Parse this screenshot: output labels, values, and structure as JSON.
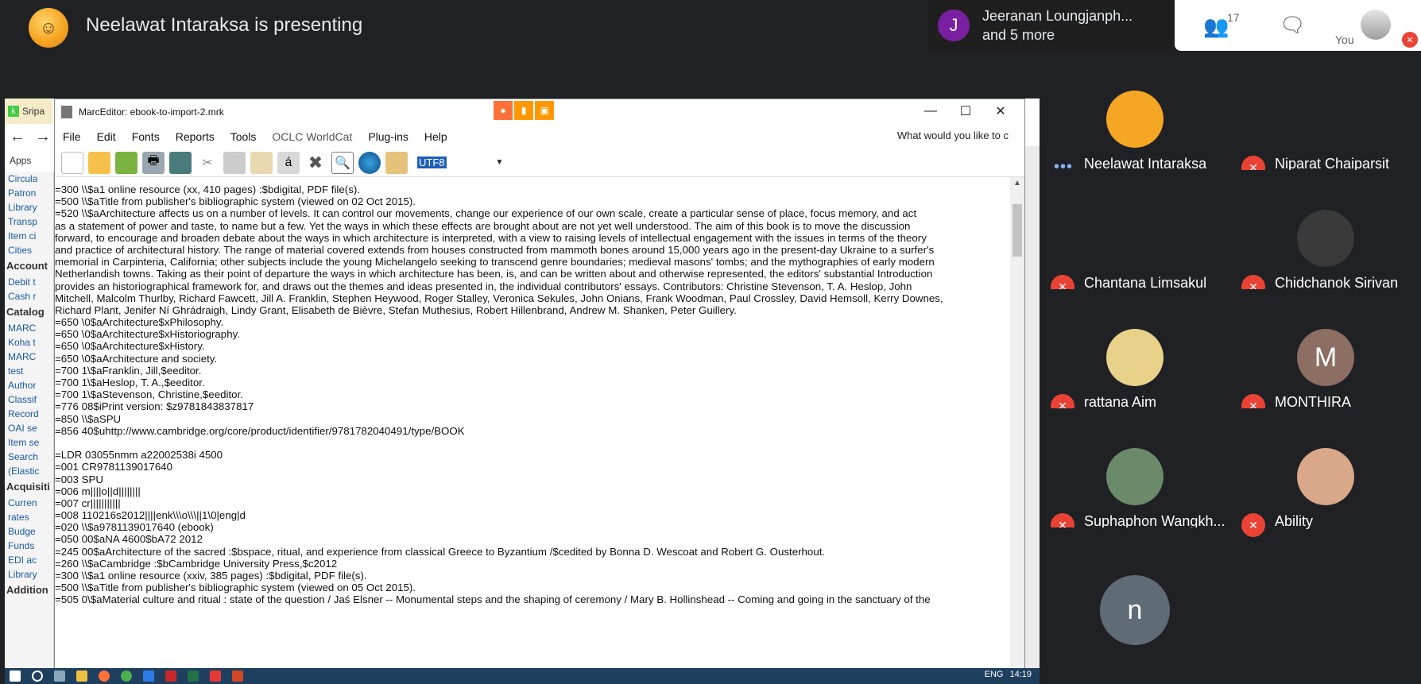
{
  "meet": {
    "presenting_text": "Neelawat Intaraksa is presenting",
    "top_participant": {
      "initial": "J",
      "line1": "Jeeranan Loungjanph...",
      "line2": "and 5 more",
      "color": "#7b1fa2"
    },
    "people_count": "17",
    "you_label": "You"
  },
  "browser": {
    "tab_label": "Sripa",
    "apps_label": "Apps"
  },
  "koha_sidebar": [
    {
      "t": "ln",
      "text": "Circula"
    },
    {
      "t": "ln",
      "text": "Patron"
    },
    {
      "t": "ln",
      "text": "Library"
    },
    {
      "t": "ln",
      "text": "Transp"
    },
    {
      "t": "ln",
      "text": "Item ci"
    },
    {
      "t": "ln",
      "text": "Cities"
    },
    {
      "t": "hd",
      "text": "Account"
    },
    {
      "t": "ln",
      "text": "Debit t"
    },
    {
      "t": "ln",
      "text": "Cash r"
    },
    {
      "t": "hd",
      "text": "Catalog"
    },
    {
      "t": "ln",
      "text": "MARC"
    },
    {
      "t": "ln",
      "text": "Koha t"
    },
    {
      "t": "ln",
      "text": "MARC"
    },
    {
      "t": "ln",
      "text": "test"
    },
    {
      "t": "ln",
      "text": "Author"
    },
    {
      "t": "ln",
      "text": "Classif"
    },
    {
      "t": "ln",
      "text": "Record"
    },
    {
      "t": "ln",
      "text": "OAI se"
    },
    {
      "t": "ln",
      "text": "Item se"
    },
    {
      "t": "ln",
      "text": "Search"
    },
    {
      "t": "ln",
      "text": "(Elastic"
    },
    {
      "t": "hd",
      "text": "Acquisiti"
    },
    {
      "t": "ln",
      "text": "Curren"
    },
    {
      "t": "ln",
      "text": "rates"
    },
    {
      "t": "ln",
      "text": "Budge"
    },
    {
      "t": "ln",
      "text": "Funds"
    },
    {
      "t": "ln",
      "text": "EDI ac"
    },
    {
      "t": "ln",
      "text": "Library"
    },
    {
      "t": "hd",
      "text": "Addition"
    }
  ],
  "marc": {
    "title": "MarcEditor: ebook-to-import-2.mrk",
    "window_controls": {
      "minimize": "—",
      "maximize": "☐",
      "close": "✕"
    },
    "menu": [
      "File",
      "Edit",
      "Fonts",
      "Reports",
      "Tools",
      "OCLC WorldCat",
      "Plug-ins",
      "Help"
    ],
    "search_hint": "What would you like to c",
    "encoding": "UTF8",
    "lines": [
      "=300  \\\\$a1 online resource (xx, 410 pages) :$bdigital, PDF file(s).",
      "=500  \\\\$aTitle from publisher's bibliographic system (viewed on 02 Oct 2015).",
      "=520  \\\\$aArchitecture affects us on a number of levels. It can control our movements, change our experience of our own scale, create a particular sense of place, focus memory, and act",
      "as a statement of power and taste, to name but a few. Yet the ways in which these effects are brought about are not yet well understood. The aim of this book is to move the discussion",
      "forward, to encourage and broaden debate about the ways in which architecture is interpreted, with a view to raising levels of intellectual engagement with the issues in terms of the theory",
      "and practice of architectural history. The range of material covered extends from houses constructed from mammoth bones around 15,000 years ago in the present-day Ukraine to a surfer's",
      "memorial in Carpinteria, California; other subjects include the young Michelangelo seeking to transcend genre boundaries; medieval masons' tombs; and the mythographies of early modern",
      "Netherlandish towns. Taking as their point of departure the ways in which architecture has been, is, and can be written about and otherwise represented, the editors' substantial Introduction",
      "provides an historiographical framework for, and draws out the themes and ideas presented in, the individual contributors' essays. Contributors: Christine Stevenson, T. A. Heslop, John",
      "Mitchell, Malcolm Thurlby, Richard Fawcett, Jill A. Franklin, Stephen Heywood, Roger Stalley, Veronica Sekules, John Onians, Frank Woodman, Paul Crossley, David Hemsoll, Kerry Downes,",
      "Richard Plant, Jenifer Ní Ghrádraigh, Lindy Grant, Elisabeth de Bièvre, Stefan Muthesius, Robert Hillenbrand, Andrew M. Shanken, Peter Guillery.",
      "=650  \\0$aArchitecture$xPhilosophy.",
      "=650  \\0$aArchitecture$xHistoriography.",
      "=650  \\0$aArchitecture$xHistory.",
      "=650  \\0$aArchitecture and society.",
      "=700  1\\$aFranklin, Jill,$eeditor.",
      "=700  1\\$aHeslop, T. A.,$eeditor.",
      "=700  1\\$aStevenson, Christine,$eeditor.",
      "=776  08$iPrint version: $z9781843837817",
      "=850  \\\\$aSPU",
      "=856  40$uhttp://www.cambridge.org/core/product/identifier/9781782040491/type/BOOK",
      "",
      "=LDR  03055nmm a22002538i 4500",
      "=001  CR9781139017640",
      "=003  SPU",
      "=006  m||||o||d||||||||",
      "=007  cr|||||||||||",
      "=008  110216s2012||||enk\\\\\\o\\\\\\||1\\0|eng|d",
      "=020  \\\\$a9781139017640 (ebook)",
      "=050  00$aNA 4600$bA72 2012",
      "=245  00$aArchitecture of the sacred :$bspace, ritual, and experience from classical Greece to Byzantium /$cedited by Bonna D. Wescoat and Robert G. Ousterhout.",
      "=260  \\\\$aCambridge :$bCambridge University Press,$c2012",
      "=300  \\\\$a1 online resource (xxiv, 385 pages) :$bdigital, PDF file(s).",
      "=500  \\\\$aTitle from publisher's bibliographic system (viewed on 05 Oct 2015).",
      "=505  0\\$aMaterial culture and ritual : state of the question / Jaś Elsner -- Monumental steps and the shaping of ceremony / Mary B. Hollinshead -- Coming and going in the sanctuary of the"
    ]
  },
  "taskbar": {
    "lang": "ENG",
    "time": "14:19"
  },
  "participants": [
    {
      "name": "Neelawat Intaraksa",
      "speaking": true,
      "avatar_color": "#f5a623",
      "initial": ""
    },
    {
      "name": "Niparat Chaiparsit",
      "speaking": false,
      "avatar_color": "",
      "initial": ""
    },
    {
      "name": "Chantana Limsakul",
      "speaking": false,
      "avatar_color": "",
      "initial": ""
    },
    {
      "name": "Chidchanok Sirivan",
      "speaking": false,
      "avatar_color": "#3a3a3a",
      "initial": ""
    },
    {
      "name": "rattana Aim",
      "speaking": false,
      "avatar_color": "#e8d28a",
      "initial": ""
    },
    {
      "name": "MONTHIRA",
      "speaking": false,
      "avatar_color": "#8d6e63",
      "initial": "M"
    },
    {
      "name": "Suphaphon Wangkh...",
      "speaking": false,
      "avatar_color": "#6a8a6a",
      "initial": ""
    },
    {
      "name": "Ability",
      "speaking": false,
      "avatar_color": "#d9a888",
      "initial": ""
    },
    {
      "name": "",
      "speaking": false,
      "avatar_color": "#5f6b75",
      "initial": "n"
    }
  ]
}
